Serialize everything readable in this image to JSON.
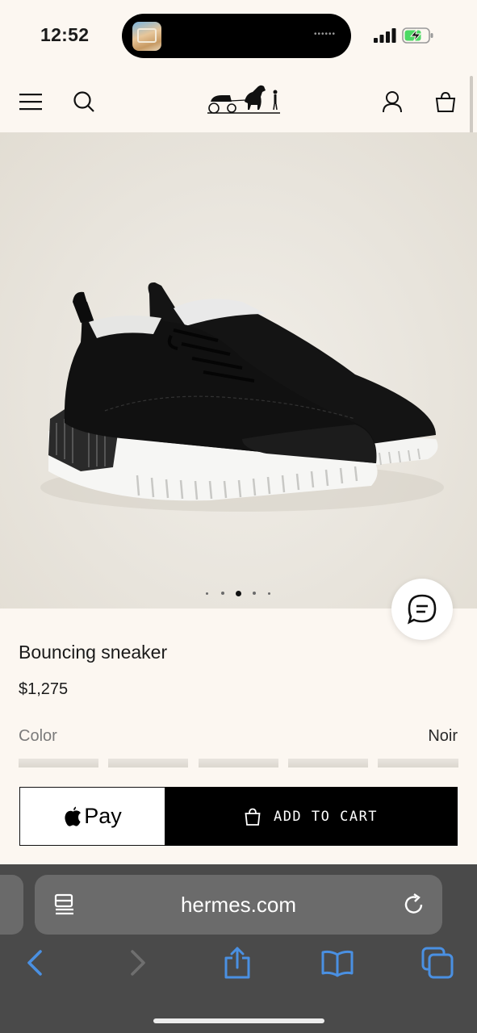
{
  "status_bar": {
    "time": "12:52",
    "island_activity_dots": "••••••"
  },
  "header": {
    "menu_icon": "hamburger-icon",
    "search_icon": "search-icon",
    "logo": "hermes-carriage-logo",
    "account_icon": "person-icon",
    "bag_icon": "shopping-bag-icon"
  },
  "product": {
    "title": "Bouncing sneaker",
    "price": "$1,275",
    "color_label": "Color",
    "color_value": "Noir",
    "image_alt": "black leather and suede sneaker with white sole",
    "carousel": {
      "count": 5,
      "active_index": 2
    }
  },
  "actions": {
    "applepay_label": "Pay",
    "add_to_cart_label": "ADD TO CART"
  },
  "browser": {
    "url": "hermes.com"
  },
  "colors": {
    "page_bg": "#fcf7f1",
    "accent_black": "#000000",
    "safari_blue": "#4a90e2"
  }
}
